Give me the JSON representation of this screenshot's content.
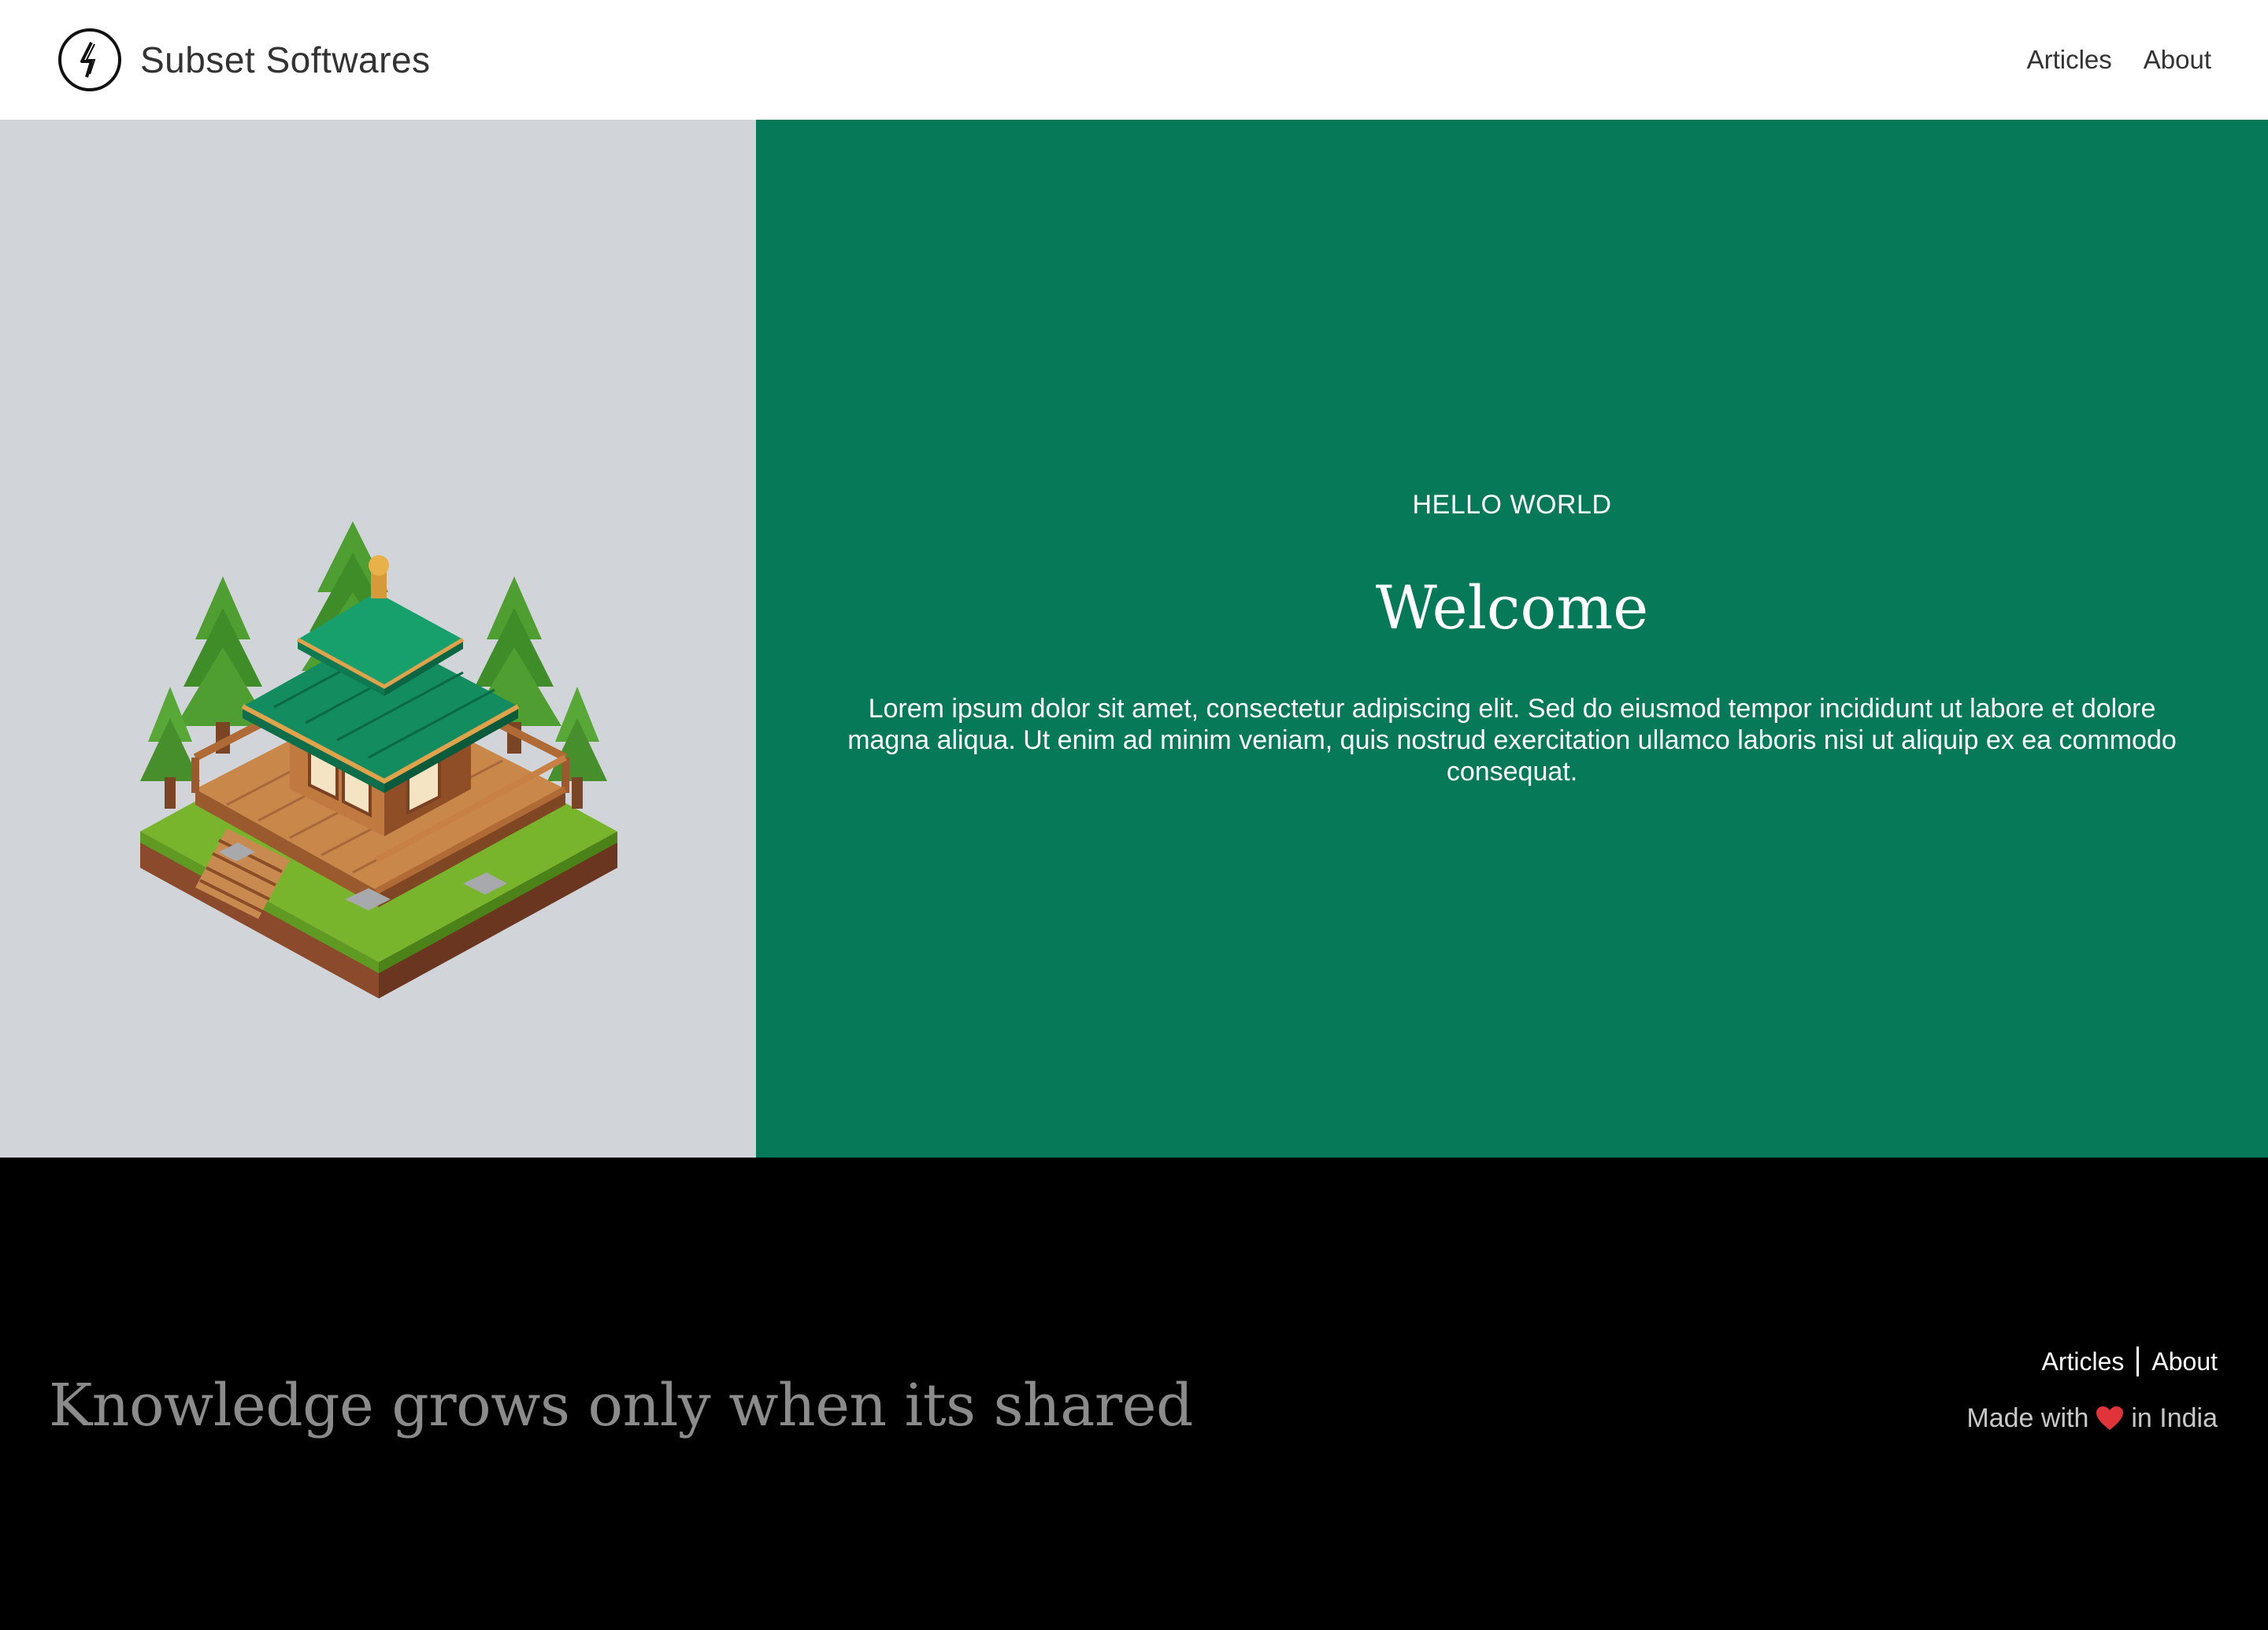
{
  "header": {
    "brand_name": "Subset Softwares",
    "nav": [
      {
        "label": "Articles"
      },
      {
        "label": "About"
      }
    ]
  },
  "hero": {
    "eyebrow": "HELLO WORLD",
    "title": "Welcome",
    "body": "Lorem ipsum dolor sit amet, consectetur adipiscing elit. Sed do eiusmod tempor incididunt ut labore et dolore magna aliqua. Ut enim ad minim veniam, quis nostrud exercitation ullamco laboris nisi ut aliquip ex ea commodo consequat.",
    "image_icon": "isometric-pagoda-house-illustration"
  },
  "footer": {
    "tagline": "Knowledge grows only when its shared",
    "links": [
      {
        "label": "Articles"
      },
      {
        "label": "About"
      }
    ],
    "made_with_prefix": "Made with",
    "made_with_suffix": "in India",
    "heart_icon": "heart-icon"
  },
  "colors": {
    "hero_accent": "#067a58",
    "hero_left_bg": "#d1d4d9",
    "footer_bg": "#000000",
    "heart": "#e0343a"
  }
}
